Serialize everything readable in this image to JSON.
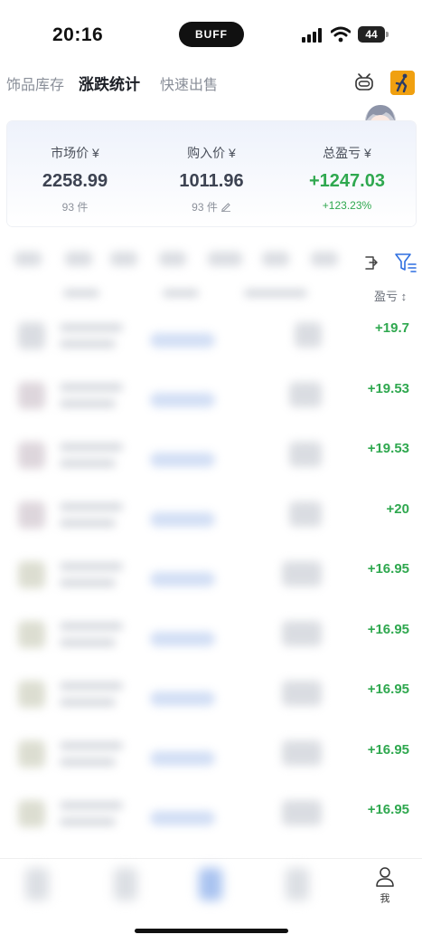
{
  "status_bar": {
    "time": "20:16",
    "island_logo": "BUFF",
    "battery": "44"
  },
  "tabs": [
    {
      "label": "饰品库存",
      "active": false
    },
    {
      "label": "涨跌统计",
      "active": true
    },
    {
      "label": "快速出售",
      "active": false
    }
  ],
  "header_icons": [
    "robot-icon",
    "game-icon",
    "avatar"
  ],
  "summary": {
    "market": {
      "label": "市场价 ¥",
      "value": "2258.99",
      "count": "93 件"
    },
    "purchase": {
      "label": "购入价 ¥",
      "value": "1011.96",
      "count": "93 件"
    },
    "profit": {
      "label": "总盈亏 ¥",
      "value": "+1247.03",
      "percent": "+123.23%"
    }
  },
  "toolbar_icons": [
    "share-icon",
    "filter-icon"
  ],
  "table": {
    "profit_header": "盈亏 ↕",
    "rows": [
      {
        "profit": "+19.7"
      },
      {
        "profit": "+19.53"
      },
      {
        "profit": "+19.53"
      },
      {
        "profit": "+20"
      },
      {
        "profit": "+16.95"
      },
      {
        "profit": "+16.95"
      },
      {
        "profit": "+16.95"
      },
      {
        "profit": "+16.95"
      },
      {
        "profit": "+16.95"
      }
    ]
  },
  "bottom_nav": {
    "me_label": "我"
  },
  "colors": {
    "positive": "#2fa84f",
    "text_dark": "#3d4352",
    "accent_blue": "#2f6fe0"
  }
}
